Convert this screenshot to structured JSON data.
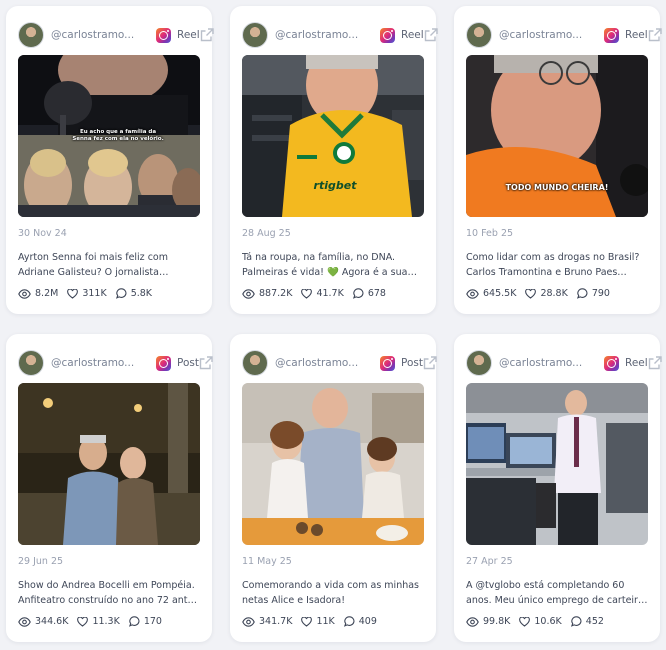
{
  "posts": [
    {
      "username": "@carlostramo...",
      "type": "Reel",
      "date": "30 Nov 24",
      "caption_line1": "Ayrton Senna foi mais feliz com",
      "caption_line2": "Adriane Galisteu? O jornalista…",
      "views": "8.2M",
      "likes": "311K",
      "comments": "5.8K",
      "overlay_text": "Eu acho que a família da Senna fez com ela no velório."
    },
    {
      "username": "@carlostramo...",
      "type": "Reel",
      "date": "28 Aug 25",
      "caption_line1": "Tá na roupa, na família, no DNA.",
      "caption_line2": "Palmeiras é vida! 💚 Agora é a sua…",
      "views": "887.2K",
      "likes": "41.7K",
      "comments": "678",
      "overlay_text": "rtigbet"
    },
    {
      "username": "@carlostramo...",
      "type": "Reel",
      "date": "10 Feb 25",
      "caption_line1": "Como lidar com as drogas no Brasil?",
      "caption_line2": "Carlos Tramontina e Bruno Paes…",
      "views": "645.5K",
      "likes": "28.8K",
      "comments": "790",
      "overlay_text": "TODO MUNDO CHEIRA!"
    },
    {
      "username": "@carlostramo...",
      "type": "Post",
      "date": "29 Jun 25",
      "caption_line1": "Show do Andrea Bocelli em Pompéia.",
      "caption_line2": "Anfiteatro construído no ano 72 antes…",
      "views": "344.6K",
      "likes": "11.3K",
      "comments": "170",
      "overlay_text": ""
    },
    {
      "username": "@carlostramo...",
      "type": "Post",
      "date": "11 May 25",
      "caption_line1": "Comemorando a vida com as minhas",
      "caption_line2": "netas Alice e Isadora!",
      "views": "341.7K",
      "likes": "11K",
      "comments": "409",
      "overlay_text": ""
    },
    {
      "username": "@carlostramo...",
      "type": "Reel",
      "date": "27 Apr 25",
      "caption_line1": "A @tvglobo está completando 60",
      "caption_line2": "anos. Meu único emprego de carteira…",
      "views": "99.8K",
      "likes": "10.6K",
      "comments": "452",
      "overlay_text": ""
    }
  ],
  "icons": {
    "views": "eye-icon",
    "likes": "heart-icon",
    "comments": "comment-icon",
    "platform": "instagram-icon",
    "open": "external-link-icon"
  },
  "colors": {
    "background": "#f1f2f6",
    "card": "#ffffff",
    "text": "#3e4657",
    "muted": "#9aa1b1"
  }
}
